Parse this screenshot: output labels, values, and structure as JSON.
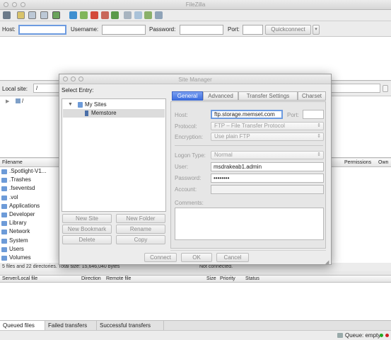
{
  "app": {
    "title": "FileZilla"
  },
  "quickconnect": {
    "host_label": "Host:",
    "username_label": "Username:",
    "password_label": "Password:",
    "port_label": "Port:",
    "button_label": "Quickconnect",
    "dropdown_arrow": "▾"
  },
  "local": {
    "site_label": "Local site:",
    "site_path": "/",
    "tree_root": "/",
    "list_headers": {
      "filename": "Filename"
    },
    "files": [
      ".Spotlight-V1...",
      ".Trashes",
      ".fseventsd",
      ".vol",
      "Applications",
      "Developer",
      "Library",
      "Network",
      "System",
      "Users",
      "Volumes"
    ],
    "status": "5 files and 22 directories. Total size: 15,646,040 bytes"
  },
  "remote": {
    "list_headers": {
      "permissions": "Permissions",
      "owner": "Own"
    },
    "status": "Not connected."
  },
  "queue": {
    "headers": {
      "server_local": "Server/Local file",
      "direction": "Direction",
      "remote_file": "Remote file",
      "size": "Size",
      "priority": "Priority",
      "status": "Status"
    },
    "tabs": [
      "Queued files",
      "Failed transfers",
      "Successful transfers"
    ],
    "footer": "Queue: empty"
  },
  "site_manager": {
    "title": "Site Manager",
    "select_entry": "Select Entry:",
    "tree": {
      "folder": "My Sites",
      "site": "Memstore"
    },
    "buttons": {
      "new_site": "New Site",
      "new_folder": "New Folder",
      "new_bookmark": "New Bookmark",
      "rename": "Rename",
      "delete": "Delete",
      "copy": "Copy"
    },
    "tabs": [
      "General",
      "Advanced",
      "Transfer Settings",
      "Charset"
    ],
    "general": {
      "host_label": "Host:",
      "host_value": "ftp.storage.memset.com",
      "port_label": "Port:",
      "port_value": "",
      "protocol_label": "Protocol:",
      "protocol_value": "FTP – File Transfer Protocol",
      "encryption_label": "Encryption:",
      "encryption_value": "Use plain FTP",
      "logon_label": "Logon Type:",
      "logon_value": "Normal",
      "user_label": "User:",
      "user_value": "msdrakeab1.admin",
      "password_label": "Password:",
      "password_value": "••••••••",
      "account_label": "Account:",
      "account_value": "",
      "comments_label": "Comments:"
    },
    "footer_buttons": {
      "connect": "Connect",
      "ok": "OK",
      "cancel": "Cancel"
    }
  }
}
